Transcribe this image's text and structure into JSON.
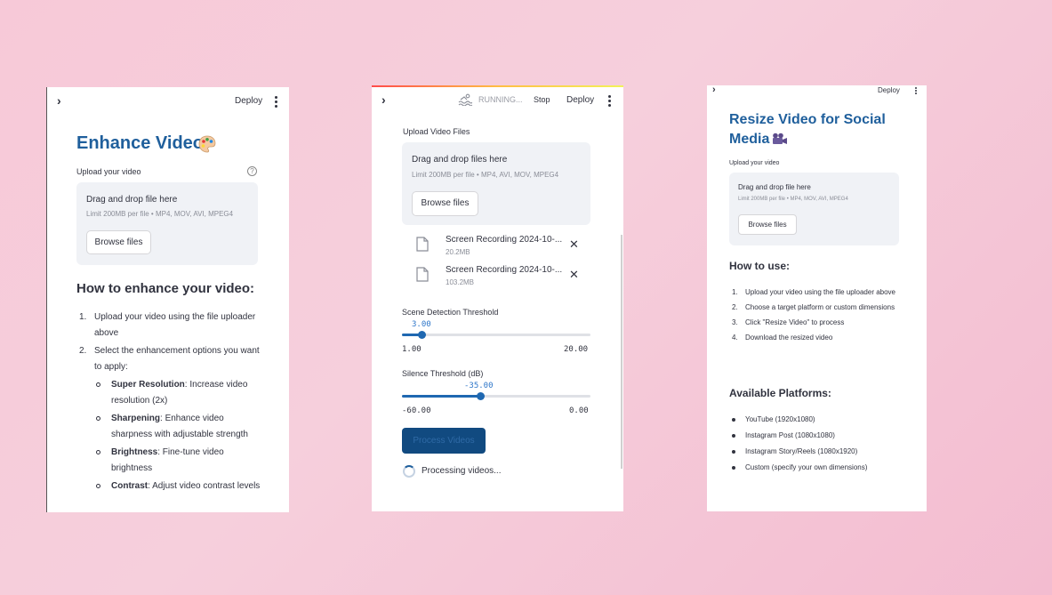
{
  "panel1": {
    "deploy_label": "Deploy",
    "title": "Enhance Video",
    "upload_label": "Upload your video",
    "help_glyph": "?",
    "dropzone": {
      "primary": "Drag and drop file here",
      "limit": "Limit 200MB per file • MP4, MOV, AVI, MPEG4",
      "browse": "Browse files"
    },
    "section_heading": "How to enhance your video:",
    "steps": [
      {
        "num": "1.",
        "text": "Upload your video using the file uploader above"
      },
      {
        "num": "2.",
        "text": "Select the enhancement options you want to apply:"
      }
    ],
    "options": [
      {
        "name": "Super Resolution",
        "desc": ": Increase video resolution (2x)"
      },
      {
        "name": "Sharpening",
        "desc": ": Enhance video sharpness with adjustable strength"
      },
      {
        "name": "Brightness",
        "desc": ": Fine-tune video brightness"
      },
      {
        "name": "Contrast",
        "desc": ": Adjust video contrast levels"
      }
    ]
  },
  "panel2": {
    "status": "RUNNING...",
    "stop_label": "Stop",
    "deploy_label": "Deploy",
    "upload_label": "Upload Video Files",
    "dropzone": {
      "primary": "Drag and drop files here",
      "limit": "Limit 200MB per file • MP4, AVI, MOV, MPEG4",
      "browse": "Browse files"
    },
    "files": [
      {
        "name": "Screen Recording 2024-10-...",
        "size": "20.2MB"
      },
      {
        "name": "Screen Recording 2024-10-...",
        "size": "103.2MB"
      }
    ],
    "remove_glyph": "✕",
    "scene_slider": {
      "label": "Scene Detection Threshold",
      "value": "3.00",
      "min": "1.00",
      "max": "20.00",
      "fraction": 0.105
    },
    "silence_slider": {
      "label": "Silence Threshold (dB)",
      "value": "-35.00",
      "min": "-60.00",
      "max": "0.00",
      "fraction": 0.417
    },
    "process_button": "Process Videos",
    "processing_text": "Processing videos..."
  },
  "panel3": {
    "deploy_label": "Deploy",
    "title": "Resize Video for Social Media",
    "upload_label": "Upload your video",
    "dropzone": {
      "primary": "Drag and drop file here",
      "limit": "Limit 200MB per file • MP4, MOV, AVI, MPEG4",
      "browse": "Browse files"
    },
    "how_heading": "How to use:",
    "steps": [
      {
        "num": "1.",
        "text": "Upload your video using the file uploader above"
      },
      {
        "num": "2.",
        "text": "Choose a target platform or custom dimensions"
      },
      {
        "num": "3.",
        "text": "Click \"Resize Video\" to process"
      },
      {
        "num": "4.",
        "text": "Download the resized video"
      }
    ],
    "platforms_heading": "Available Platforms:",
    "platforms": [
      "YouTube (1920x1080)",
      "Instagram Post (1080x1080)",
      "Instagram Story/Reels (1080x1920)",
      "Custom (specify your own dimensions)"
    ]
  },
  "colors": {
    "background": "#f7c9d8",
    "title_blue": "#1f5f9c",
    "slider_blue": "#1f68b1",
    "dropzone": "#f0f2f6"
  }
}
